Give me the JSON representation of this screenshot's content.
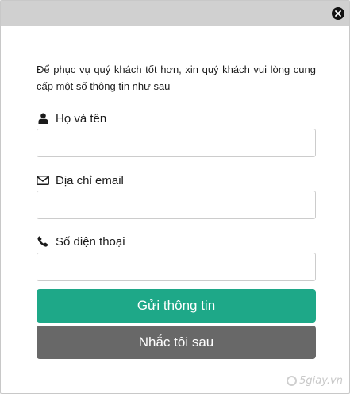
{
  "dialog": {
    "intro": "Để phục vụ quý khách tốt hơn, xin quý khách vui lòng cung cấp một số thông tin như sau"
  },
  "fields": [
    {
      "label": "Họ và tên",
      "icon": "user-icon",
      "value": ""
    },
    {
      "label": "Địa chỉ email",
      "icon": "envelope-icon",
      "value": ""
    },
    {
      "label": "Số điện thoại",
      "icon": "phone-icon",
      "value": ""
    }
  ],
  "buttons": {
    "submit_label": "Gửi thông tin",
    "later_label": "Nhắc tôi sau"
  },
  "colors": {
    "submit": "#1ea888",
    "later": "#686868",
    "title_bar": "#d0d0d0"
  },
  "watermark": "5giay.vn"
}
